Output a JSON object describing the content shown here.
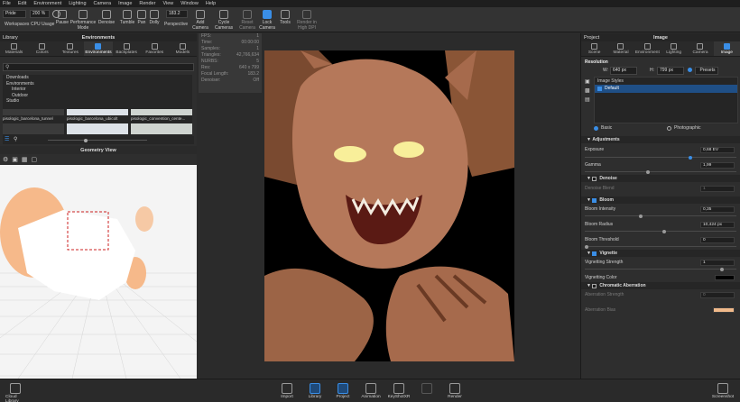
{
  "menu": [
    "File",
    "Edit",
    "Environment",
    "Lighting",
    "Camera",
    "Image",
    "Render",
    "View",
    "Window",
    "Help"
  ],
  "toolbar": {
    "mode_value": "Pride",
    "zoom_value": "200 %",
    "workspaces_label": "Workspaces",
    "cpu_label": "CPU Usage",
    "pause_label": "Pause",
    "performance_label": "Performance Mode",
    "denoise_label": "Denoise",
    "tumble_label": "Tumble",
    "pan_label": "Pan",
    "dolly_label": "Dolly",
    "perspective_label": "Perspective",
    "perspective_value": "183.2",
    "add_camera_label": "Add Camera",
    "cycle_cameras_label": "Cycle Cameras",
    "reset_camera_label": "Reset Camera",
    "lock_camera_label": "Lock Camera",
    "tools_label": "Tools",
    "render_hq_label": "Render in High DPI"
  },
  "library": {
    "title": "Library",
    "env_title": "Environments",
    "tabs": [
      "Materials",
      "Colors",
      "Textures",
      "Environments",
      "Backplates",
      "Favorites",
      "Models"
    ],
    "active_tab": "Environments",
    "tree": [
      "Downloads",
      "Environments",
      "Interior",
      "Outdoor",
      "Studio"
    ],
    "thumbs": [
      "pisologic_barcelona_tunnel",
      "pisologic_barcelona_ubicolt",
      "pisologic_convention_cente..."
    ]
  },
  "geometry": {
    "title": "Geometry View"
  },
  "stats": {
    "rows": [
      {
        "k": "FPS:",
        "v": "1"
      },
      {
        "k": "Time:",
        "v": "00:00:00"
      },
      {
        "k": "Samples:",
        "v": "1"
      },
      {
        "k": "Triangles:",
        "v": "42,766,634"
      },
      {
        "k": "NURBS:",
        "v": "5"
      },
      {
        "k": "Res:",
        "v": "640 x 799"
      },
      {
        "k": "Focal Length:",
        "v": "183.2"
      },
      {
        "k": "Denoiser:",
        "v": "Off"
      }
    ]
  },
  "project": {
    "title": "Project",
    "sub_title": "Image",
    "tabs": [
      "Scene",
      "Material",
      "Environment",
      "Lighting",
      "Camera",
      "Image"
    ],
    "active_tab": "Image",
    "resolution_label": "Resolution",
    "width_label": "W:",
    "width_value": "640 px",
    "height_label": "H:",
    "height_value": "799 px",
    "presets_label": "Presets",
    "image_styles_label": "Image Styles",
    "style_default": "Default",
    "basic_label": "Basic",
    "photographic_label": "Photographic",
    "adjustments_label": "Adjustments",
    "exposure_label": "Exposure",
    "exposure_value": "0,68 EV",
    "gamma_label": "Gamma",
    "gamma_value": "1,99",
    "denoise_label": "Denoise",
    "denoise_blend_label": "Denoise Blend",
    "denoise_blend_value": "1",
    "bloom_label": "Bloom",
    "bloom_intensity_label": "Bloom Intensity",
    "bloom_intensity_value": "0,35",
    "bloom_radius_label": "Bloom Radius",
    "bloom_radius_value": "10,424 px",
    "bloom_threshold_label": "Bloom Threshold",
    "bloom_threshold_value": "0",
    "vignette_label": "Vignette",
    "vignetting_strength_label": "Vignetting Strength",
    "vignetting_strength_value": "1",
    "vignetting_color_label": "Vignetting Color",
    "chromatic_label": "Chromatic Aberration",
    "aberration_strength_label": "Aberration Strength",
    "aberration_strength_value": "0",
    "aberration_bias_label": "Aberration Bias",
    "aberration_bias_color": "#f0b98a"
  },
  "bottom": {
    "cloud_library": "Cloud Library",
    "import": "Import",
    "library": "Library",
    "project": "Project",
    "animation": "Animation",
    "keyshotxr": "KeyShotXR",
    "render": "Render",
    "screenshot": "Screenshot"
  },
  "colors": {
    "accent": "#3a8ee6",
    "viewport_bg": "#000000",
    "panel_bg": "#2e2e2e",
    "skin": "#b5785a"
  }
}
